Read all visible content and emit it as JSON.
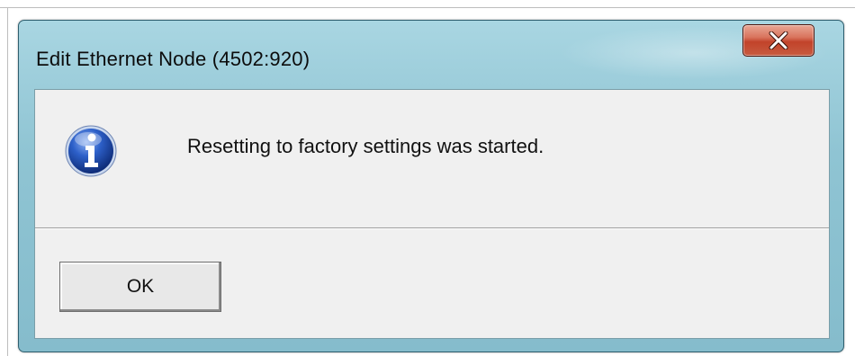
{
  "dialog": {
    "title": "Edit Ethernet Node (4502:920)",
    "close_icon": "close-icon",
    "message_icon": "info-icon",
    "message": "Resetting to factory settings was started.",
    "ok_label": "OK"
  },
  "colors": {
    "frame": "#8fc4d3",
    "client": "#f0f0f0",
    "close_button": "#c2432a",
    "info_icon": "#1f4fb8"
  }
}
